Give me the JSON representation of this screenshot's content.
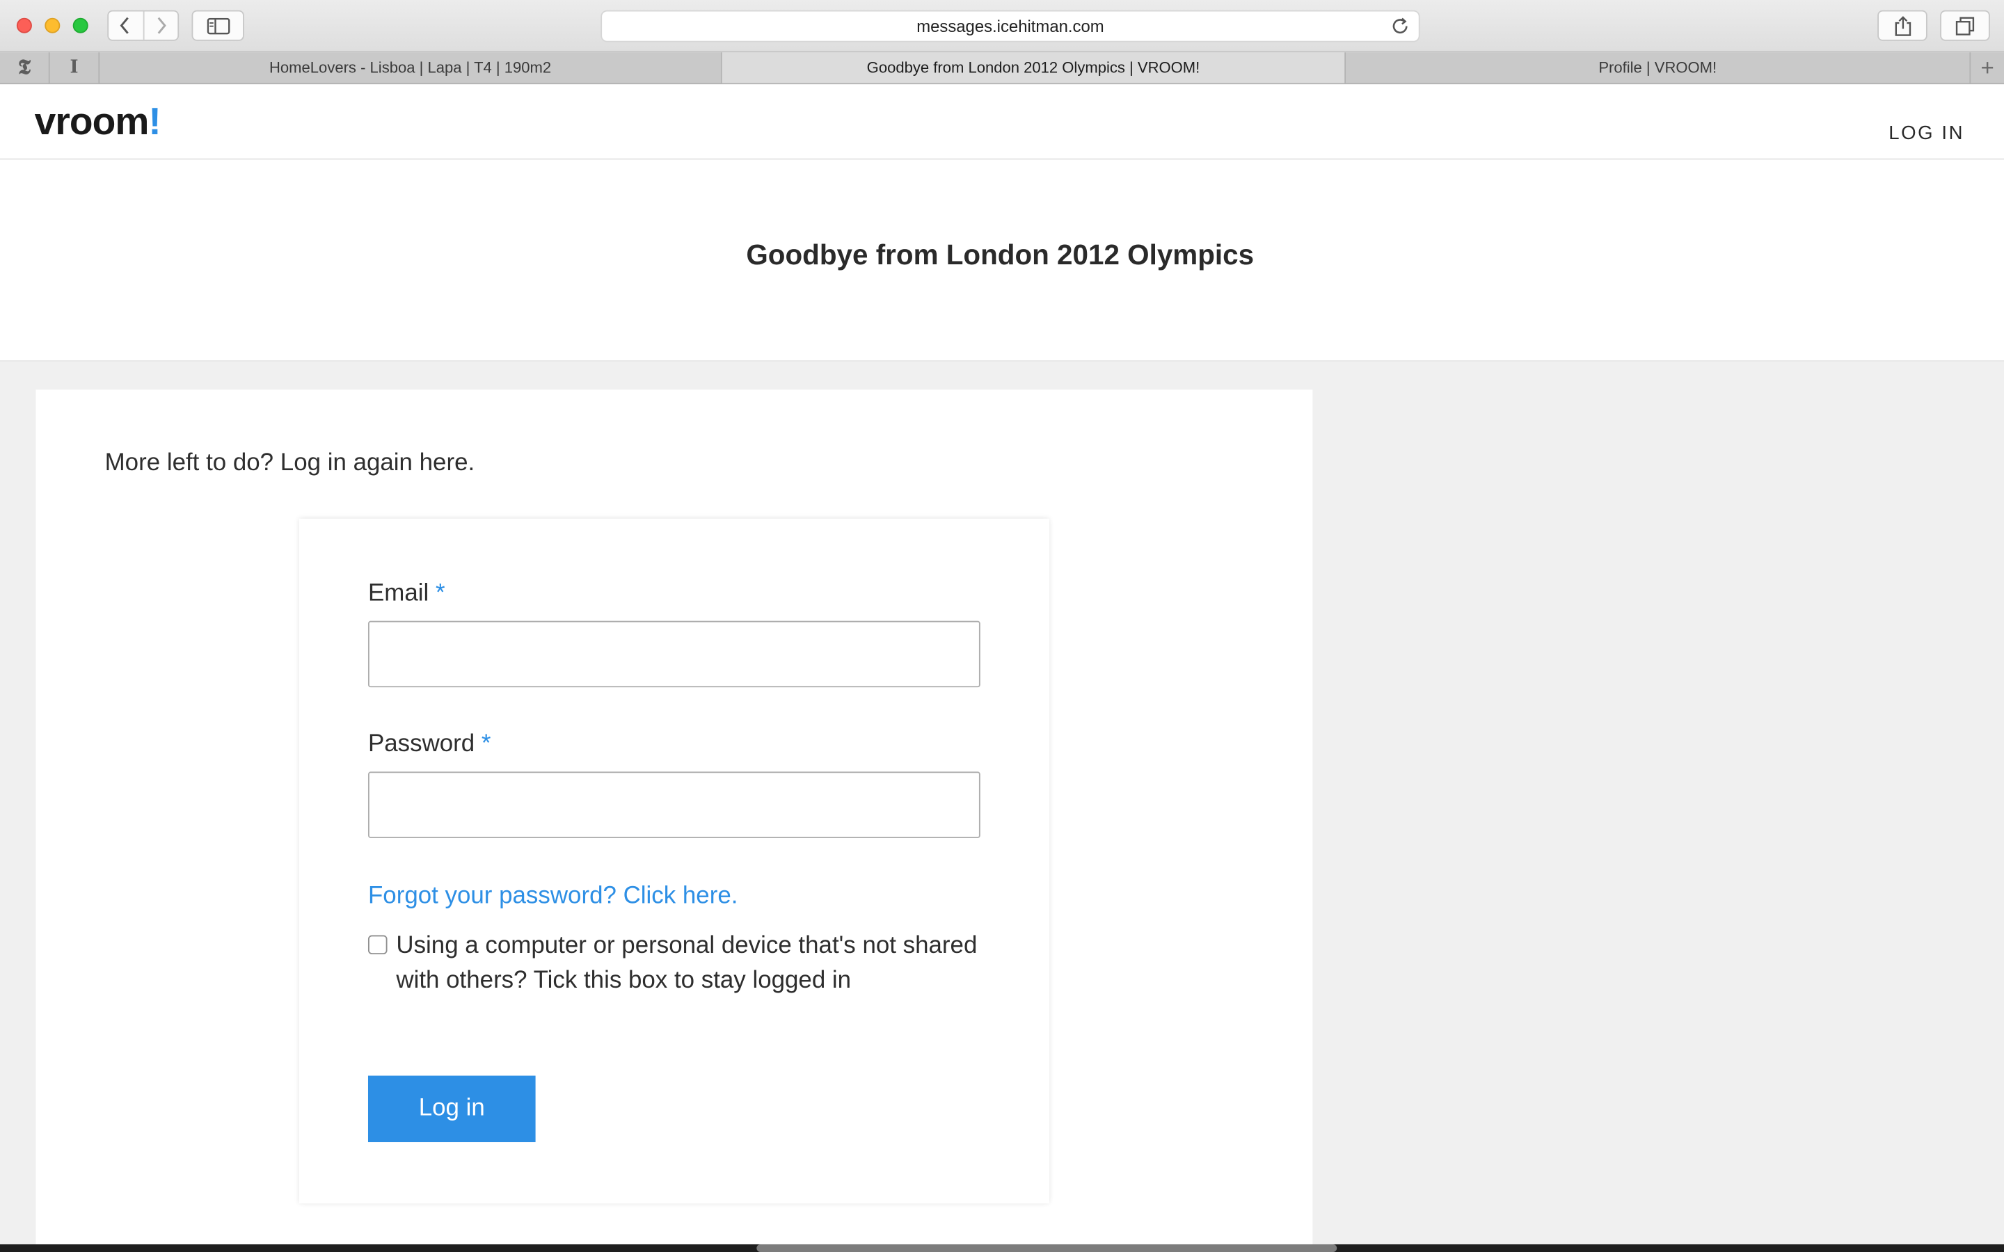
{
  "browser": {
    "url": "messages.icehitman.com",
    "pinned_tabs": [
      "𝕿",
      "I"
    ],
    "tabs": [
      {
        "label": "HomeLovers - Lisboa | Lapa | T4 | 190m2",
        "active": false
      },
      {
        "label": "Goodbye from London 2012 Olympics | VROOM!",
        "active": true
      },
      {
        "label": "Profile | VROOM!",
        "active": false
      }
    ],
    "new_tab_label": "+"
  },
  "header": {
    "logo_text": "vroom",
    "logo_accent": "!",
    "login_link": "LOG IN"
  },
  "hero": {
    "title": "Goodbye from London 2012 Olympics"
  },
  "main": {
    "intro": "More left to do? Log in again here.",
    "form": {
      "email_label": "Email",
      "email_value": "",
      "password_label": "Password",
      "password_value": "",
      "required_marker": "*",
      "forgot_link": "Forgot your password? Click here.",
      "remember_label": "Using a computer or personal device that's not shared with others? Tick this box to stay logged in",
      "remember_checked": false,
      "submit_label": "Log in"
    }
  },
  "colors": {
    "accent": "#2d8fe5",
    "text": "#2e2e2e",
    "page_bg": "#f0f0f0"
  }
}
